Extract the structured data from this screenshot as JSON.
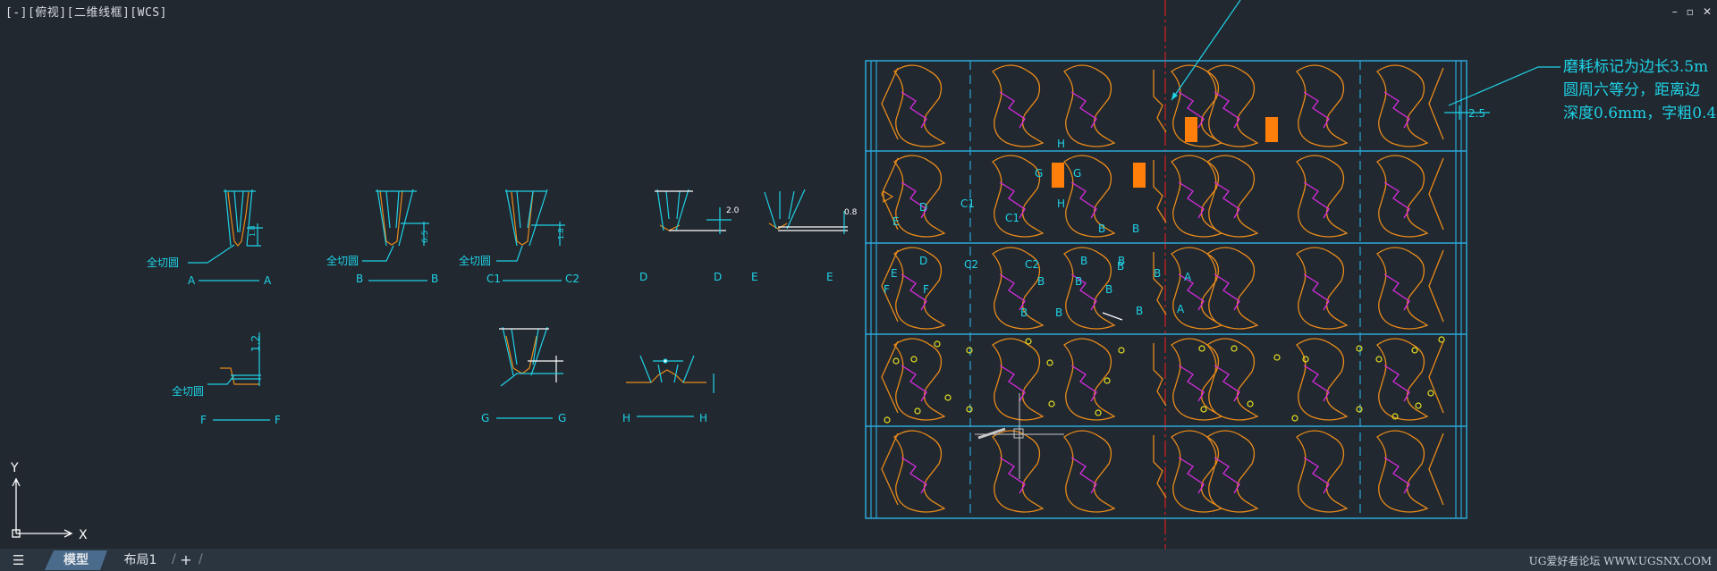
{
  "viewport": {
    "label": "[-][俯视][二维线框][WCS]"
  },
  "window_controls": {
    "minimize": "–",
    "restore": "▫",
    "close": "✕"
  },
  "ucs": {
    "x": "X",
    "y": "Y"
  },
  "sections": {
    "a": {
      "note": "全切圆",
      "left": "A",
      "right": "A"
    },
    "b": {
      "note": "全切圆",
      "left": "B",
      "right": "B",
      "dim": "6.5"
    },
    "c": {
      "note": "全切圆",
      "left": "C1",
      "right": "C2"
    },
    "d": {
      "left": "D",
      "right": "D",
      "dim": "2.0"
    },
    "e": {
      "left": "E",
      "right": "E",
      "dim": "0.8"
    },
    "f": {
      "note": "全切圆",
      "left": "F",
      "right": "F",
      "dim": "1.2"
    },
    "g": {
      "left": "G",
      "right": "G"
    },
    "h": {
      "left": "H",
      "right": "H"
    }
  },
  "drawing": {
    "dim_right": "2.5",
    "labels": [
      "H",
      "G",
      "G",
      "H",
      "D",
      "C1",
      "E",
      "D",
      "C2",
      "C1",
      "C2",
      "B",
      "B",
      "B",
      "B",
      "B",
      "B",
      "B",
      "B",
      "B",
      "B",
      "B",
      "B",
      "E",
      "F",
      "F",
      "A",
      "A"
    ]
  },
  "annotation": {
    "lines": [
      "磨耗标记为边长3.5m",
      "圆周六等分，距离边",
      "深度0.6mm，字粗0.4"
    ]
  },
  "statusbar": {
    "menu_icon": "☰",
    "tabs": [
      "模型",
      "布局1"
    ],
    "add": "+",
    "watermark": "UG爱好者论坛 WWW.UGSNX.COM"
  },
  "colors": {
    "background": "#212830",
    "cyan": "#1fd2e6",
    "orange": "#e88a1a",
    "magenta": "#d82be0",
    "red": "#d42020",
    "blue": "#2aa7d8",
    "yellow": "#e6e020"
  }
}
